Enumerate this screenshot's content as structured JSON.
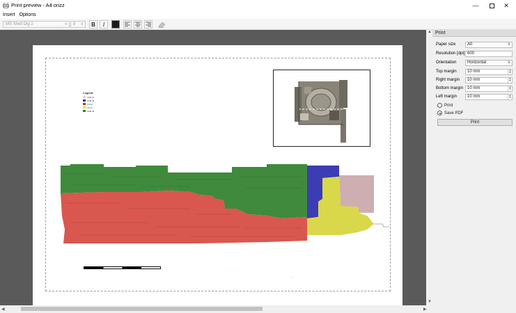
{
  "window": {
    "title": "Print preview - A4 orizz"
  },
  "menu": {
    "insert": "Insert",
    "options": "Options"
  },
  "toolbar": {
    "font": "MS Shell Dlg 2",
    "font_size": "8",
    "bold_label": "B",
    "italic_label": "I",
    "text_color": "#1a1a1a"
  },
  "legend": {
    "title": "Legend",
    "items": [
      {
        "label": "USM 10",
        "color": "#f2c8c8"
      },
      {
        "label": "USM 20",
        "color": "#2b2bb8"
      },
      {
        "label": "US 30",
        "color": "#d62a2a"
      },
      {
        "label": "US 31",
        "color": "#e8e81a"
      },
      {
        "label": "USM 35",
        "color": "#1f8a2e"
      }
    ]
  },
  "panel": {
    "header": "Print",
    "paper_size_label": "Paper size",
    "paper_size_value": "A0",
    "resolution_label": "Resolution [dpi]",
    "resolution_value": "600",
    "orientation_label": "Orientation",
    "orientation_value": "Horizontal",
    "top_margin_label": "Top margin",
    "top_margin_value": "10 mm",
    "right_margin_label": "Right margin",
    "right_margin_value": "10 mm",
    "bottom_margin_label": "Bottom margin",
    "bottom_margin_value": "10 mm",
    "left_margin_label": "Left margin",
    "left_margin_value": "10 mm",
    "print_radio": "Print",
    "save_pdf_radio": "Save PDF",
    "selected_output": "Save PDF",
    "print_button": "Print"
  }
}
